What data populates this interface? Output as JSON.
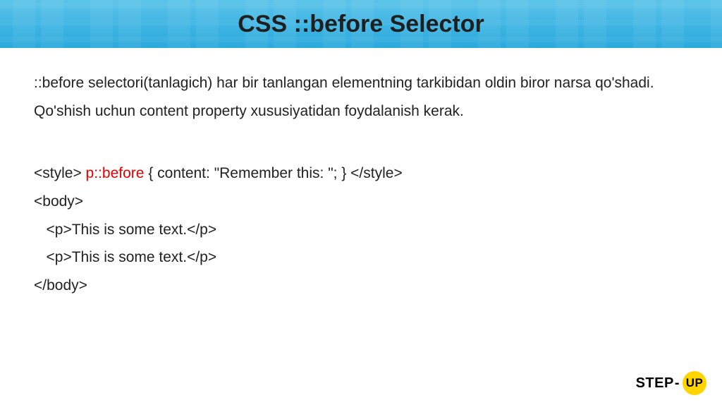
{
  "header": {
    "title": "CSS ::before Selector"
  },
  "content": {
    "description": "::before selectori(tanlagich) har bir tanlangan elementning tarkibidan oldin biror narsa qo'shadi. Qo'shish uchun content property xususiyatidan foydalanish kerak."
  },
  "code": {
    "style_open": "<style> ",
    "selector": "p::before",
    "rule": " { content: \"Remember this: \"; } </style>",
    "body_open": "<body>",
    "p1": "   <p>This is some text.</p>",
    "p2": "   <p>This is some text.</p>",
    "body_close": "</body>"
  },
  "footer": {
    "logo_step": "STEP",
    "logo_dash": "-",
    "logo_up": "UP"
  }
}
